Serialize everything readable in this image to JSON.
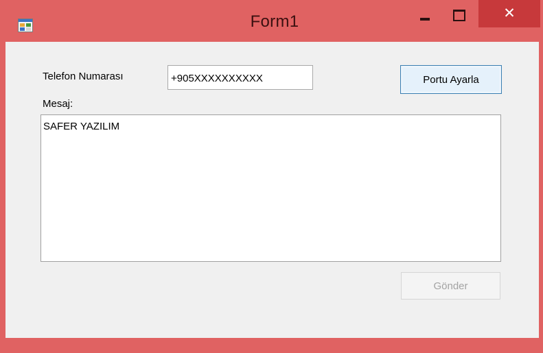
{
  "window": {
    "title": "Form1",
    "icon": "form-app-icon",
    "controls": {
      "minimize_icon": "minimize-icon",
      "maximize_icon": "maximize-icon",
      "close_glyph": "✕"
    },
    "colors": {
      "frame": "#e06262",
      "close_button": "#c7393b",
      "client_area": "#f0f0f0"
    }
  },
  "form": {
    "phone_label": "Telefon Numarası",
    "phone_value": "+905XXXXXXXXXX",
    "message_label": "Mesaj:",
    "message_value": "SAFER YAZILIM",
    "port_button_label": "Portu Ayarla",
    "send_button_label": "Gönder",
    "send_button_enabled": false
  }
}
